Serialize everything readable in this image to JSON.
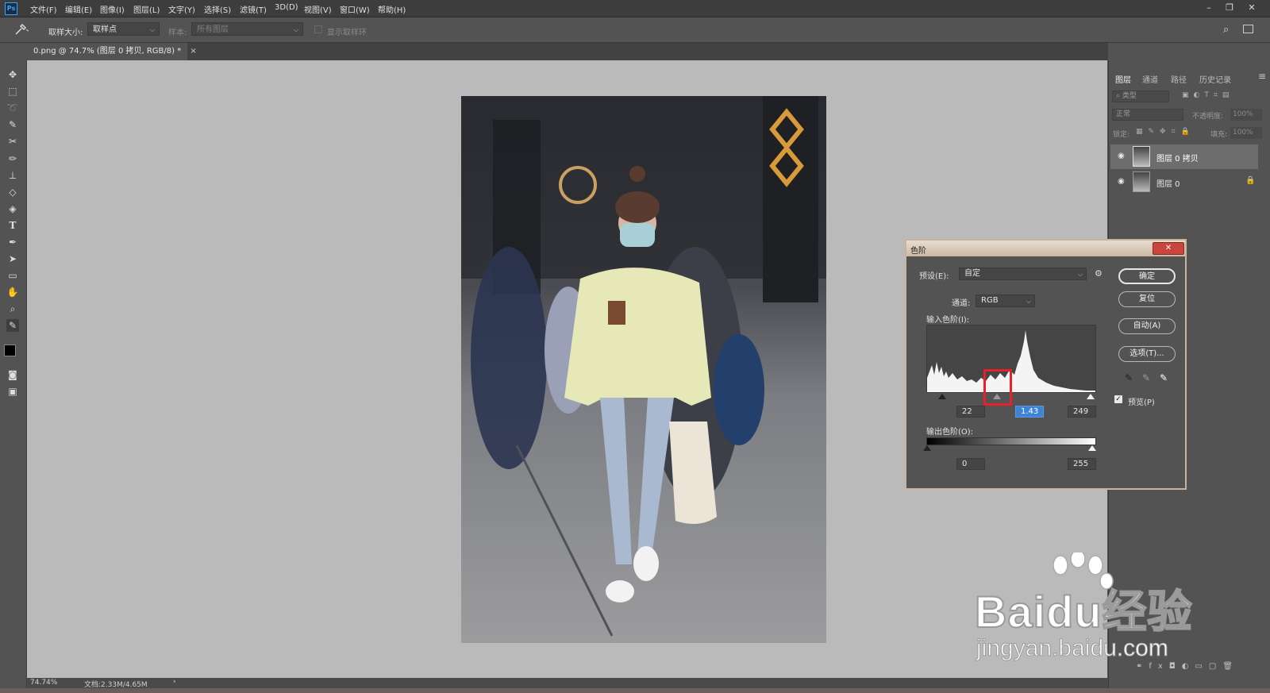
{
  "app": {
    "logo": "Ps"
  },
  "menu": [
    "文件(F)",
    "编辑(E)",
    "图像(I)",
    "图层(L)",
    "文字(Y)",
    "选择(S)",
    "滤镜(T)",
    "3D(D)",
    "视图(V)",
    "窗口(W)",
    "帮助(H)"
  ],
  "window_controls": {
    "minimize": "–",
    "restore": "❐",
    "close": "✕"
  },
  "options": {
    "sample_size_label": "取样大小:",
    "sample_size_value": "取样点",
    "sample_label": "样本:",
    "sample_value": "所有图层",
    "show_ring_label": "显示取样环"
  },
  "document": {
    "tab_title": "0.png @ 74.7% (图层 0 拷贝, RGB/8) *",
    "tab_close": "×"
  },
  "status": {
    "zoom": "74.74%",
    "doc_size": "文档:2.33M/4.65M",
    "arrow": "›"
  },
  "panel": {
    "tabs": [
      "图层",
      "通道",
      "路径",
      "历史记录"
    ],
    "filter_kind": "类型",
    "blend_mode": "正常",
    "opacity_label": "不透明度:",
    "opacity_value": "100%",
    "lock_label": "锁定:",
    "fill_label": "填充:",
    "fill_value": "100%",
    "layers": [
      {
        "name": "图层 0 拷贝",
        "selected": true,
        "locked": false
      },
      {
        "name": "图层 0",
        "selected": false,
        "locked": true
      }
    ]
  },
  "levels": {
    "title": "色阶",
    "preset_label": "预设(E):",
    "preset_value": "自定",
    "channel_label": "通道:",
    "channel_value": "RGB",
    "input_label": "输入色阶(I):",
    "input_black": "22",
    "input_gamma": "1.43",
    "input_white": "249",
    "output_label": "输出色阶(O):",
    "output_black": "0",
    "output_white": "255",
    "buttons": {
      "ok": "确定",
      "reset": "复位",
      "auto": "自动(A)",
      "options": "选项(T)..."
    },
    "preview_label": "预览(P)",
    "preview_checked": true,
    "highlight_color": "#e8202a"
  },
  "watermark": {
    "brand": "Baidu经验",
    "url": "jingyan.baidu.com"
  },
  "colors": {
    "accent": "#31a8ff",
    "selection": "#3d84d6"
  }
}
